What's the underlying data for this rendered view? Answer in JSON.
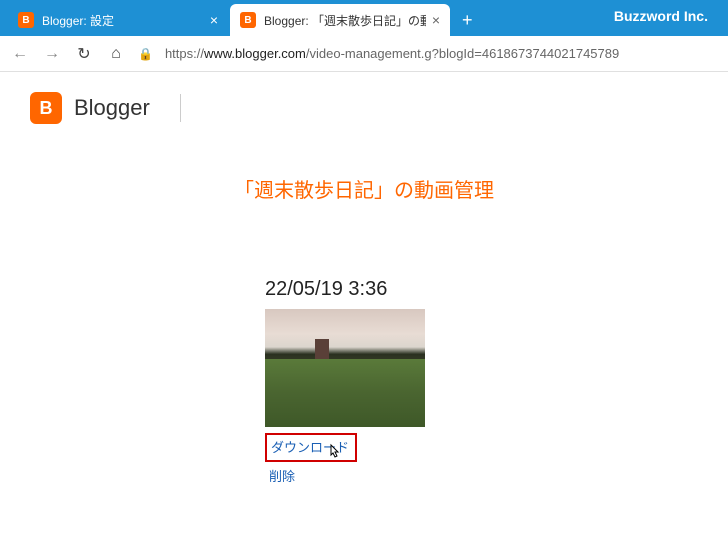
{
  "window": {
    "brand": "Buzzword Inc."
  },
  "tabs": [
    {
      "title": "Blogger: 設定",
      "active": false
    },
    {
      "title": "Blogger: 「週末散歩日記」の動画管",
      "active": true
    }
  ],
  "addressBar": {
    "protocolPath": "https://",
    "domain": "www.blogger.com",
    "path": "/video-management.g?blogId=4618673744021745789"
  },
  "header": {
    "logoLetter": "B",
    "productName": "Blogger"
  },
  "page": {
    "title": "「週末散歩日記」の動画管理"
  },
  "video": {
    "timestamp": "22/05/19 3:36",
    "downloadLabel": "ダウンロード",
    "deleteLabel": "削除"
  }
}
